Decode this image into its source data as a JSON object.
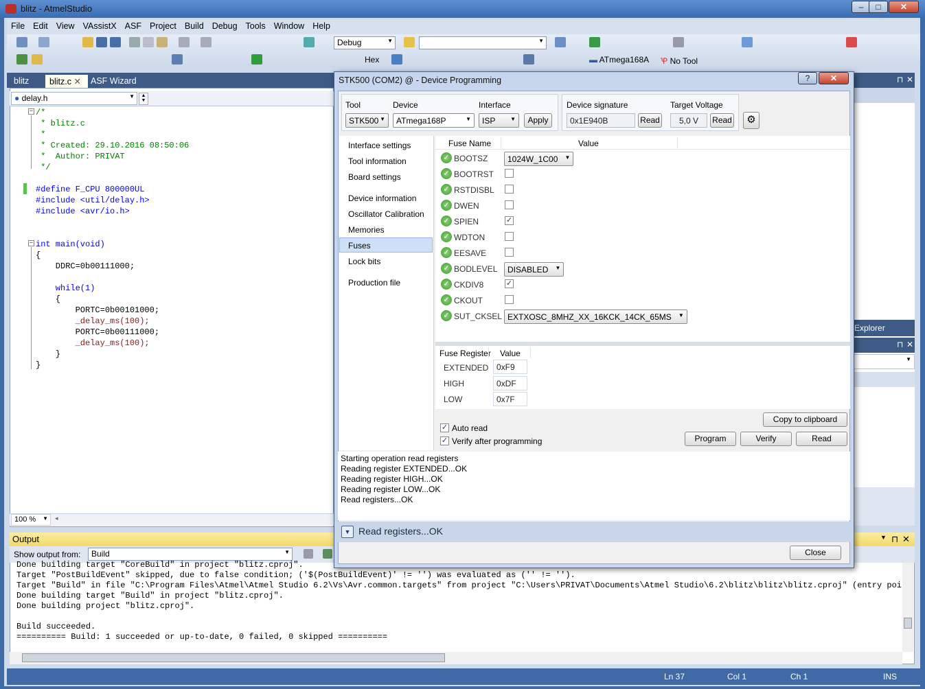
{
  "window": {
    "title": "blitz - AtmelStudio"
  },
  "menu": [
    "File",
    "Edit",
    "View",
    "VAssistX",
    "ASF",
    "Project",
    "Build",
    "Debug",
    "Tools",
    "Window",
    "Help"
  ],
  "toolbar": {
    "config": "Debug",
    "platform": "",
    "hex_label": "Hex",
    "device": "ATmega168A",
    "tool": "No Tool"
  },
  "tabs": [
    "blitz",
    "blitz.c",
    "ASF Wizard"
  ],
  "editor": {
    "nav_file": "delay.h",
    "zoom": "100 %",
    "lines": [
      {
        "t": "/*",
        "c": "cm",
        "y": 0
      },
      {
        "t": " * blitz.c",
        "c": "cm",
        "y": 1
      },
      {
        "t": " *",
        "c": "cm",
        "y": 2
      },
      {
        "t": " * Created: 29.10.2016 08:50:06",
        "c": "cm",
        "y": 3
      },
      {
        "t": " *  Author: PRIVAT",
        "c": "cm",
        "y": 4
      },
      {
        "t": " */",
        "c": "cm",
        "y": 5
      },
      {
        "t": "",
        "c": "pp",
        "y": 6
      },
      {
        "t": "#define F_CPU 800000UL",
        "c": "kw",
        "y": 7
      },
      {
        "t": "#include <util/delay.h>",
        "c": "kw",
        "y": 8
      },
      {
        "t": "#include <avr/io.h>",
        "c": "kw",
        "y": 9
      },
      {
        "t": "",
        "c": "pp",
        "y": 10
      },
      {
        "t": "",
        "c": "pp",
        "y": 11
      },
      {
        "t": "int main(void)",
        "c": "kw",
        "y": 12
      },
      {
        "t": "{",
        "c": "pp",
        "y": 13
      },
      {
        "t": "    DDRC=0b00111000;",
        "c": "pp",
        "y": 14
      },
      {
        "t": "",
        "c": "pp",
        "y": 15
      },
      {
        "t": "    while(1)",
        "c": "kw",
        "y": 16
      },
      {
        "t": "    {",
        "c": "pp",
        "y": 17
      },
      {
        "t": "        PORTC=0b00101000;",
        "c": "pp",
        "y": 18
      },
      {
        "t": "        _delay_ms(100);",
        "c": "fn",
        "y": 19
      },
      {
        "t": "        PORTC=0b00111000;",
        "c": "pp",
        "y": 20
      },
      {
        "t": "        _delay_ms(100);",
        "c": "fn",
        "y": 21
      },
      {
        "t": "    }",
        "c": "pp",
        "y": 22
      },
      {
        "t": "}",
        "c": "pp",
        "y": 23
      }
    ]
  },
  "output": {
    "title": "Output",
    "show_from_label": "Show output from:",
    "source": "Build",
    "lines": [
      "Done building target \"CoreBuild\" in project \"blitz.cproj\".",
      "Target \"PostBuildEvent\" skipped, due to false condition; ('$(PostBuildEvent)' != '') was evaluated as ('' != '').",
      "Target \"Build\" in file \"C:\\Program Files\\Atmel\\Atmel Studio 6.2\\Vs\\Avr.common.targets\" from project \"C:\\Users\\PRIVAT\\Documents\\Atmel Studio\\6.2\\blitz\\blitz\\blitz.cproj\" (entry point):",
      "Done building target \"Build\" in project \"blitz.cproj\".",
      "Done building project \"blitz.cproj\".",
      "",
      "Build succeeded.",
      "========== Build: 1 succeeded or up-to-date, 0 failed, 0 skipped =========="
    ]
  },
  "status": {
    "ln": "Ln 37",
    "col": "Col 1",
    "ch": "Ch 1",
    "ins": "INS"
  },
  "right_panel": {
    "explorer": "Explorer"
  },
  "dialog": {
    "title": "STK500 (COM2) @  - Device Programming",
    "tool_label": "Tool",
    "tool": "STK500",
    "device_label": "Device",
    "device": "ATmega168P",
    "interface_label": "Interface",
    "interface": "ISP",
    "apply": "Apply",
    "sig_label": "Device signature",
    "signature": "0x1E940B",
    "read": "Read",
    "volt_label": "Target Voltage",
    "voltage": "5,0 V",
    "nav": [
      "Interface settings",
      "Tool information",
      "Board settings",
      "Device information",
      "Oscillator Calibration",
      "Memories",
      "Fuses",
      "Lock bits",
      "Production file"
    ],
    "fuse_col_name": "Fuse Name",
    "fuse_col_value": "Value",
    "fuses": [
      {
        "name": "BOOTSZ",
        "type": "select",
        "value": "1024W_1C00"
      },
      {
        "name": "BOOTRST",
        "type": "check",
        "checked": false
      },
      {
        "name": "RSTDISBL",
        "type": "check",
        "checked": false
      },
      {
        "name": "DWEN",
        "type": "check",
        "checked": false
      },
      {
        "name": "SPIEN",
        "type": "check",
        "checked": true
      },
      {
        "name": "WDTON",
        "type": "check",
        "checked": false
      },
      {
        "name": "EESAVE",
        "type": "check",
        "checked": false
      },
      {
        "name": "BODLEVEL",
        "type": "select",
        "value": "DISABLED"
      },
      {
        "name": "CKDIV8",
        "type": "check",
        "checked": true
      },
      {
        "name": "CKOUT",
        "type": "check",
        "checked": false
      },
      {
        "name": "SUT_CKSEL",
        "type": "select",
        "value": "EXTXOSC_8MHZ_XX_16KCK_14CK_65MS"
      }
    ],
    "reg_col_name": "Fuse Register",
    "reg_col_value": "Value",
    "registers": [
      {
        "name": "EXTENDED",
        "value": "0xF9"
      },
      {
        "name": "HIGH",
        "value": "0xDF"
      },
      {
        "name": "LOW",
        "value": "0x7F"
      }
    ],
    "auto_read": "Auto read",
    "verify_after": "Verify after programming",
    "copy": "Copy to clipboard",
    "program": "Program",
    "verify": "Verify",
    "read_btn": "Read",
    "log": [
      "Starting operation read registers",
      "Reading register EXTENDED...OK",
      "Reading register HIGH...OK",
      "Reading register LOW...OK",
      "Read registers...OK"
    ],
    "status": "Read registers...OK",
    "close": "Close"
  }
}
